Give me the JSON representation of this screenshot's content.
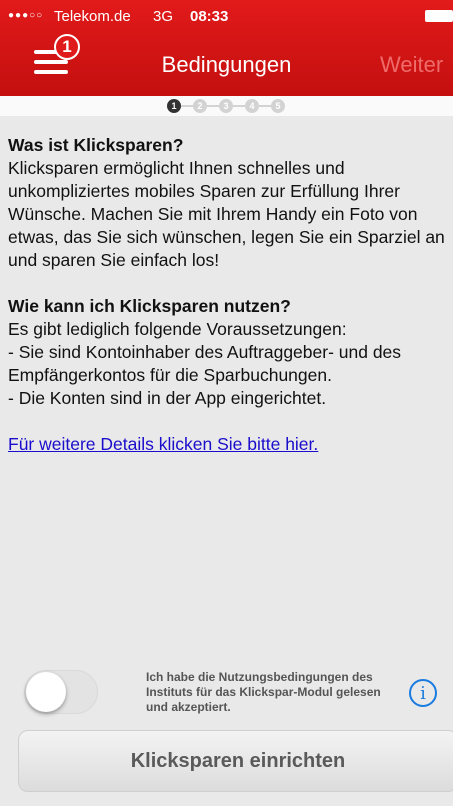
{
  "statusbar": {
    "signal": "●●●○○",
    "carrier": "Telekom.de",
    "network": "3G",
    "time": "08:33"
  },
  "header": {
    "title": "Bedingungen",
    "next_label": "Weiter",
    "menu_badge": "1"
  },
  "steps": {
    "items": [
      "1",
      "2",
      "3",
      "4",
      "5"
    ],
    "active": 1
  },
  "content": {
    "heading1": "Was ist Klicksparen?",
    "paragraph1": "Klicksparen ermöglicht Ihnen schnelles und unkompliziertes mobiles Sparen zur Erfüllung Ihrer Wünsche. Machen Sie mit Ihrem Handy ein Foto von etwas, das Sie sich wünschen, legen Sie ein Sparziel an und sparen Sie einfach los!",
    "heading2": "Wie kann ich Klicksparen nutzen?",
    "line1": "Es gibt lediglich folgende Voraussetzungen:",
    "line2": "- Sie sind Kontoinhaber des Auftraggeber- und des Empfängerkontos für die Sparbuchungen.",
    "line3": "- Die Konten sind in der App eingerichtet.",
    "link": "Für weitere Details klicken Sie bitte hier."
  },
  "consent": {
    "text": "Ich habe die Nutzungsbedingungen des Instituts für das Klickspar-Modul gelesen und akzeptiert.",
    "toggle_on": false,
    "info_icon": "i"
  },
  "button": {
    "label": "Klicksparen einrichten"
  },
  "colors": {
    "header_red": "#d81414",
    "link_blue": "#1a0dcc",
    "info_blue": "#1a7be0"
  }
}
